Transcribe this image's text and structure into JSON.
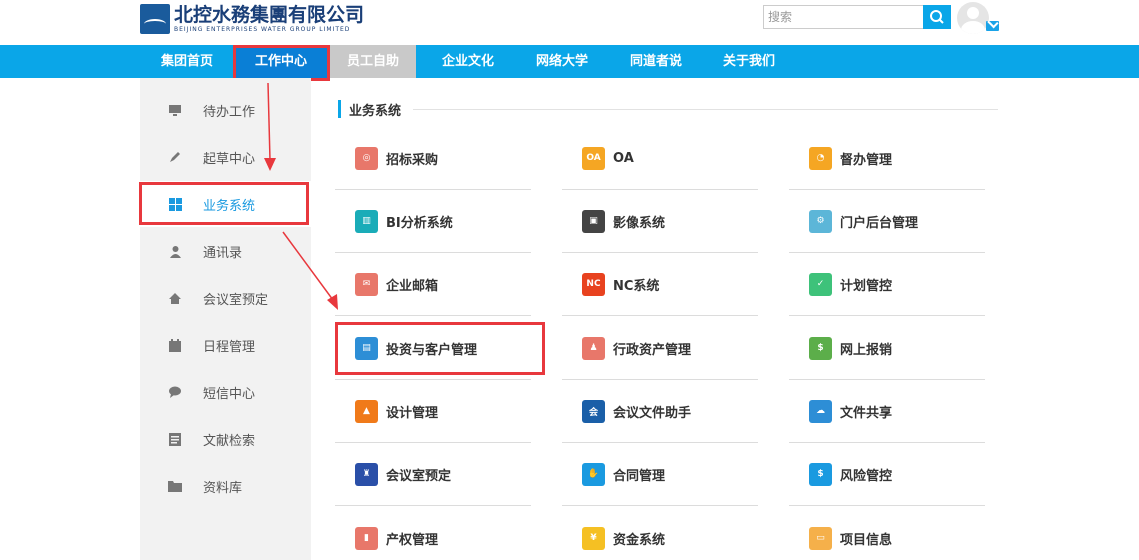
{
  "header": {
    "logo_cn": "北控水務集團有限公司",
    "logo_en": "BEIJING ENTERPRISES WATER GROUP LIMITED",
    "search_placeholder": "搜索"
  },
  "nav": [
    {
      "label": "集团首页",
      "name": "nav-group-home"
    },
    {
      "label": "工作中心",
      "name": "nav-work-center"
    },
    {
      "label": "员工自助",
      "name": "nav-employee-self-service"
    },
    {
      "label": "企业文化",
      "name": "nav-corporate-culture"
    },
    {
      "label": "网络大学",
      "name": "nav-online-university"
    },
    {
      "label": "同道者说",
      "name": "nav-colleague-talk"
    },
    {
      "label": "关于我们",
      "name": "nav-about-us"
    }
  ],
  "sidebar": [
    {
      "label": "待办工作",
      "icon": "monitor-icon"
    },
    {
      "label": "起草中心",
      "icon": "pen-icon"
    },
    {
      "label": "业务系统",
      "icon": "grid-icon"
    },
    {
      "label": "通讯录",
      "icon": "person-icon"
    },
    {
      "label": "会议室预定",
      "icon": "home-icon"
    },
    {
      "label": "日程管理",
      "icon": "calendar-icon"
    },
    {
      "label": "短信中心",
      "icon": "chat-bubble-icon"
    },
    {
      "label": "文献检索",
      "icon": "document-icon"
    },
    {
      "label": "资料库",
      "icon": "folder-icon"
    }
  ],
  "section_title": "业务系统",
  "tiles": [
    {
      "label": "招标采购",
      "icon": "target-icon",
      "color": "#e8776a",
      "glyph": "◎"
    },
    {
      "label": "OA",
      "icon": "oa-icon",
      "color": "#f5a623",
      "glyph": "OA"
    },
    {
      "label": "督办管理",
      "icon": "pie-chart-icon",
      "color": "#f5a623",
      "glyph": "◔"
    },
    {
      "label": "BI分析系统",
      "icon": "bar-chart-icon",
      "color": "#1aacb8",
      "glyph": "▥"
    },
    {
      "label": "影像系统",
      "icon": "image-icon",
      "color": "#444444",
      "glyph": "▣"
    },
    {
      "label": "门户后台管理",
      "icon": "folder-gear-icon",
      "color": "#5cb6d8",
      "glyph": "⚙"
    },
    {
      "label": "企业邮箱",
      "icon": "envelope-icon",
      "color": "#e8776a",
      "glyph": "✉"
    },
    {
      "label": "NC系统",
      "icon": "nc-icon",
      "color": "#e8421f",
      "glyph": "NC"
    },
    {
      "label": "计划管控",
      "icon": "checklist-icon",
      "color": "#3ec27a",
      "glyph": "✓"
    },
    {
      "label": "投资与客户管理",
      "icon": "briefcase-icon",
      "color": "#2d8ed6",
      "glyph": "▤"
    },
    {
      "label": "行政资产管理",
      "icon": "people-icon",
      "color": "#e8776a",
      "glyph": "♟"
    },
    {
      "label": "网上报销",
      "icon": "dollar-icon",
      "color": "#5cae4a",
      "glyph": "$"
    },
    {
      "label": "设计管理",
      "icon": "cone-icon",
      "color": "#f07a1a",
      "glyph": "▲"
    },
    {
      "label": "会议文件助手",
      "icon": "hat-icon",
      "color": "#1a5fa8",
      "glyph": "会"
    },
    {
      "label": "文件共享",
      "icon": "cloud-share-icon",
      "color": "#2d8ed6",
      "glyph": "☁"
    },
    {
      "label": "会议室预定",
      "icon": "meeting-icon",
      "color": "#2a4fa8",
      "glyph": "♜"
    },
    {
      "label": "合同管理",
      "icon": "handshake-icon",
      "color": "#1a9ae0",
      "glyph": "✋"
    },
    {
      "label": "风险管控",
      "icon": "shield-icon",
      "color": "#1a9ae0",
      "glyph": "$"
    },
    {
      "label": "产权管理",
      "icon": "building-icon",
      "color": "#e8776a",
      "glyph": "▮"
    },
    {
      "label": "资金系统",
      "icon": "moneybag-icon",
      "color": "#f5c023",
      "glyph": "¥"
    },
    {
      "label": "项目信息",
      "icon": "folder-icon",
      "color": "#f5b04a",
      "glyph": "▭"
    }
  ]
}
